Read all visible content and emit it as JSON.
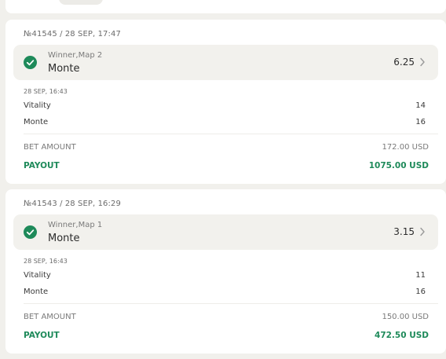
{
  "colors": {
    "background": "#f1f0ec",
    "card": "#ffffff",
    "accent_green": "#1e8a5a",
    "selection_bg": "#f2f1ed"
  },
  "bets": [
    {
      "header": "№41545 / 28 SEP, 17:47",
      "market": "Winner,Map 2",
      "pick": "Monte",
      "odds": "6.25",
      "score_time": "28 SEP, 16:43",
      "teams": [
        {
          "name": "Vitality",
          "score": "14"
        },
        {
          "name": "Monte",
          "score": "16"
        }
      ],
      "bet_amount_label": "BET AMOUNT",
      "bet_amount": "172.00 USD",
      "payout_label": "PAYOUT",
      "payout": "1075.00 USD",
      "status_icon": "check-circle-icon"
    },
    {
      "header": "№41543 / 28 SEP, 16:29",
      "market": "Winner,Map 1",
      "pick": "Monte",
      "odds": "3.15",
      "score_time": "28 SEP, 16:43",
      "teams": [
        {
          "name": "Vitality",
          "score": "11"
        },
        {
          "name": "Monte",
          "score": "16"
        }
      ],
      "bet_amount_label": "BET AMOUNT",
      "bet_amount": "150.00 USD",
      "payout_label": "PAYOUT",
      "payout": "472.50 USD",
      "status_icon": "check-circle-icon"
    }
  ]
}
